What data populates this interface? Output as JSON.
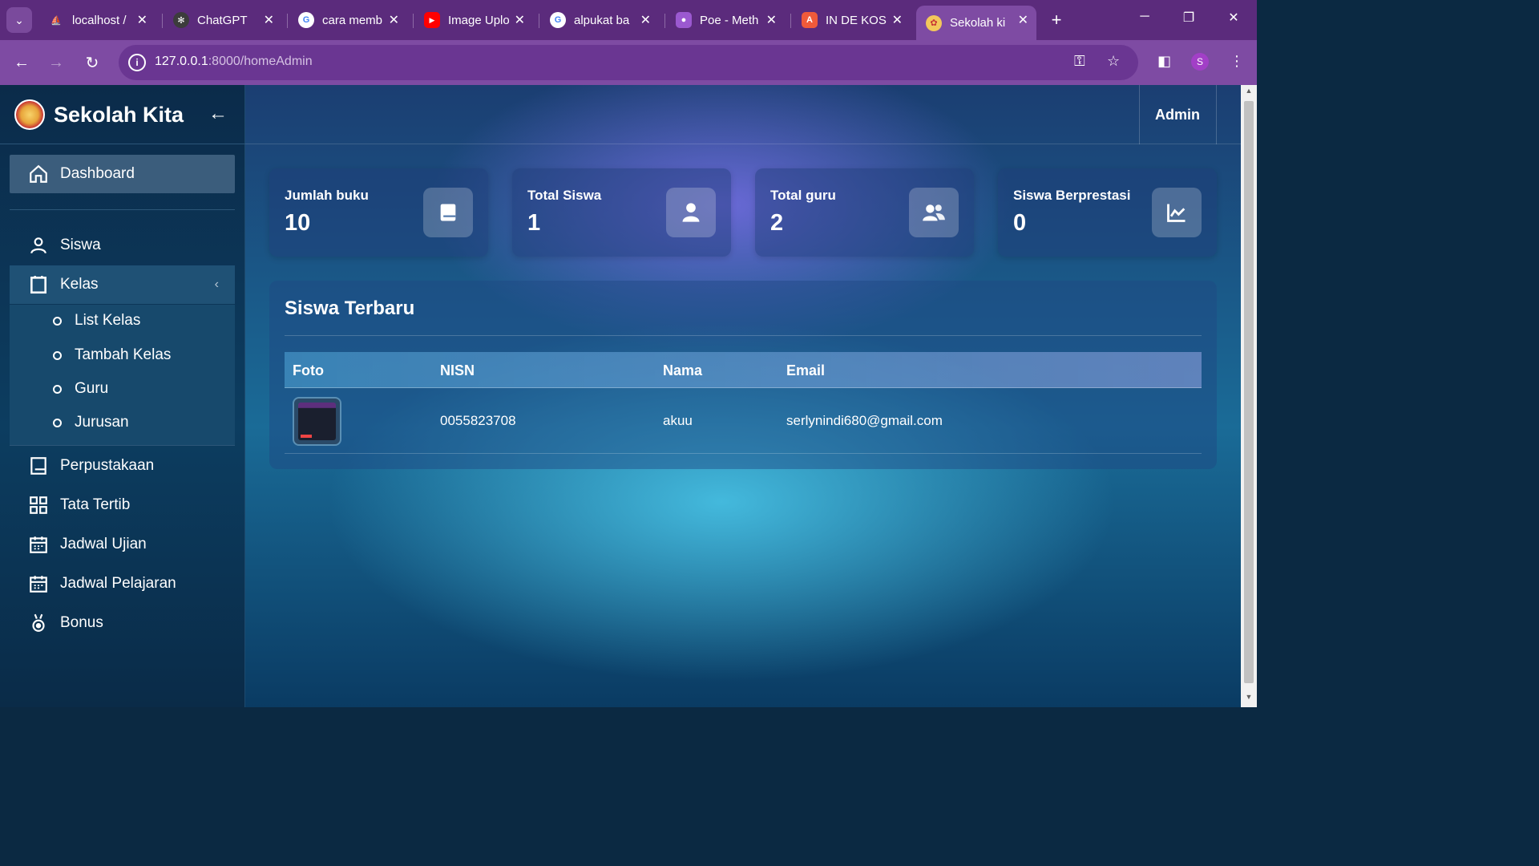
{
  "browser": {
    "tabs": [
      {
        "title": "localhost /",
        "favicon": "phpmyadmin-icon",
        "fav_color": "#e8a33b",
        "fav_glyph": "⛵"
      },
      {
        "title": "ChatGPT",
        "favicon": "chatgpt-icon",
        "fav_color": "#10a37f",
        "fav_glyph": "✻"
      },
      {
        "title": "cara memb",
        "favicon": "google-icon",
        "fav_color": "#ffffff",
        "fav_glyph": "G"
      },
      {
        "title": "Image Uplo",
        "favicon": "youtube-icon",
        "fav_color": "#ff0000",
        "fav_glyph": "▶"
      },
      {
        "title": "alpukat ba",
        "favicon": "google-icon",
        "fav_color": "#ffffff",
        "fav_glyph": "G"
      },
      {
        "title": "Poe - Meth",
        "favicon": "poe-icon",
        "fav_color": "#9b59d0",
        "fav_glyph": "●"
      },
      {
        "title": "IN DE KOS",
        "favicon": "app-a-icon",
        "fav_color": "#f05a3a",
        "fav_glyph": "A"
      },
      {
        "title": "Sekolah ki",
        "favicon": "school-logo-icon",
        "fav_color": "#f3c75b",
        "fav_glyph": "✿"
      }
    ],
    "url_host": "127.0.0.1",
    "url_path": ":8000/homeAdmin",
    "profile_initial": "S",
    "accent": "#7e4ba3"
  },
  "sidebar": {
    "brand": "Sekolah Kita",
    "dashboard": "Dashboard",
    "items": [
      {
        "label": "Siswa"
      },
      {
        "label": "Kelas"
      },
      {
        "label": "Perpustakaan"
      },
      {
        "label": "Tata Tertib"
      },
      {
        "label": "Jadwal Ujian"
      },
      {
        "label": "Jadwal Pelajaran"
      },
      {
        "label": "Bonus"
      }
    ],
    "kelas_sub": [
      "List Kelas",
      "Tambah Kelas",
      "Guru",
      "Jurusan"
    ]
  },
  "topbar": {
    "user": "Admin"
  },
  "stats": [
    {
      "label": "Jumlah buku",
      "value": "10",
      "icon": "book-icon"
    },
    {
      "label": "Total Siswa",
      "value": "1",
      "icon": "user-icon"
    },
    {
      "label": "Total guru",
      "value": "2",
      "icon": "users-icon"
    },
    {
      "label": "Siswa Berprestasi",
      "value": "0",
      "icon": "chart-line-icon"
    }
  ],
  "recent": {
    "title": "Siswa Terbaru",
    "columns": [
      "Foto",
      "NISN",
      "Nama",
      "Email"
    ],
    "rows": [
      {
        "nisn": "0055823708",
        "nama": "akuu",
        "email": "serlynindi680@gmail.com"
      }
    ]
  }
}
